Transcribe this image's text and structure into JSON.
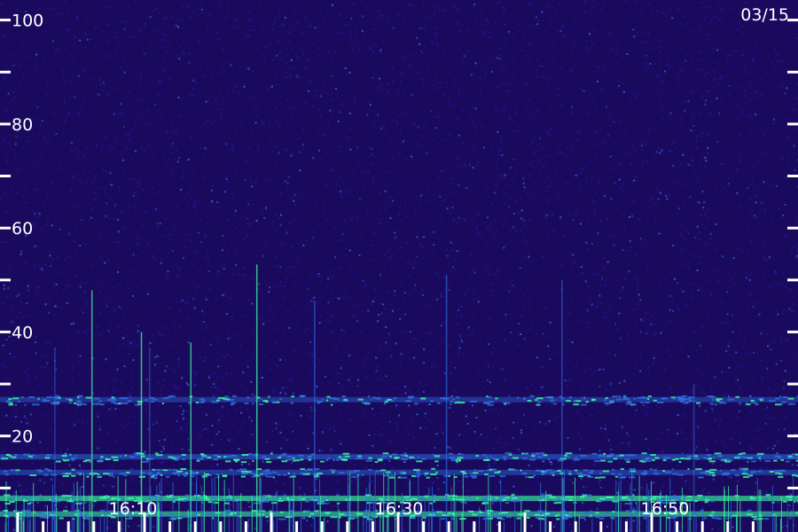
{
  "chart_data": {
    "type": "heatmap",
    "date": "03/15",
    "y_ticks": [
      100,
      80,
      60,
      40,
      20
    ],
    "y_minor_ticks": [
      90,
      70,
      50,
      30,
      10
    ],
    "ylim": [
      0,
      103
    ],
    "x_tick_labels": [
      "16:10",
      "16:30",
      "16:50"
    ],
    "xlim_minutes_after": [
      0,
      60
    ],
    "colors": {
      "background": "#1a0a5e",
      "low": "#2a12a0",
      "mid": "#2f6fe0",
      "high": "#39ffa0",
      "axis": "#ffffff"
    },
    "bands": [
      {
        "y": 27,
        "strength": 0.55
      },
      {
        "y": 16,
        "strength": 0.7
      },
      {
        "y": 13,
        "strength": 0.6
      },
      {
        "y": 8,
        "strength": 0.85
      },
      {
        "y": 5,
        "strength": 0.75
      }
    ],
    "streaks": [
      {
        "t": 9.0,
        "y_top": 48,
        "strength": 0.7
      },
      {
        "t": 15.0,
        "y_top": 40,
        "strength": 0.75
      },
      {
        "t": 21.0,
        "y_top": 38,
        "strength": 0.7
      },
      {
        "t": 29.0,
        "y_top": 53,
        "strength": 0.75
      },
      {
        "t": 36.0,
        "y_top": 46,
        "strength": 0.6
      },
      {
        "t": 52.0,
        "y_top": 51,
        "strength": 0.65
      },
      {
        "t": 66.0,
        "y_top": 50,
        "strength": 0.55
      },
      {
        "t": 82.0,
        "y_top": 30,
        "strength": 0.5
      },
      {
        "t": 16.0,
        "y_top": 37,
        "strength": 0.5
      },
      {
        "t": 4.5,
        "y_top": 37,
        "strength": 0.45
      }
    ]
  }
}
